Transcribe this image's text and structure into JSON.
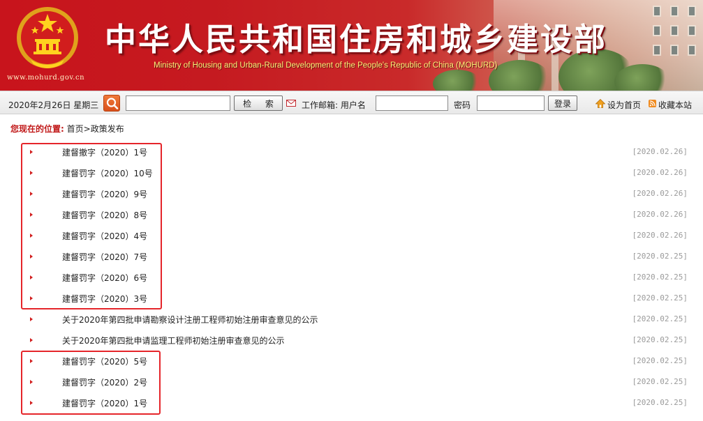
{
  "header": {
    "url": "www.mohurd.gov.cn",
    "title": "中华人民共和国住房和城乡建设部",
    "subtitle": "Ministry of Housing and Urban-Rural Development of the People's Republic of China (MOHURD)",
    "colors": {
      "banner_red": "#c8141c",
      "title_text": "#ffffff",
      "subtitle_text": "#fff27a"
    }
  },
  "toolbar": {
    "date": "2020年2月26日 星期三",
    "search_value": "",
    "search_button": "检 索",
    "mail_label": "工作邮箱: 用户名",
    "username_value": "",
    "password_label": "密码",
    "password_value": "",
    "login_button": "登录",
    "set_home": "设为首页",
    "bookmark": "收藏本站"
  },
  "breadcrumb": {
    "label": "您现在的位置:",
    "home": "首页",
    "separator": ">",
    "current": "政策发布"
  },
  "list": {
    "items": [
      {
        "title": "建督撤字（2020）1号",
        "date": "[2020.02.26]"
      },
      {
        "title": "建督罚字（2020）10号",
        "date": "[2020.02.26]"
      },
      {
        "title": "建督罚字（2020）9号",
        "date": "[2020.02.26]"
      },
      {
        "title": "建督罚字（2020）8号",
        "date": "[2020.02.26]"
      },
      {
        "title": "建督罚字（2020）4号",
        "date": "[2020.02.26]"
      },
      {
        "title": "建督罚字（2020）7号",
        "date": "[2020.02.25]"
      },
      {
        "title": "建督罚字（2020）6号",
        "date": "[2020.02.25]"
      },
      {
        "title": "建督罚字（2020）3号",
        "date": "[2020.02.25]"
      },
      {
        "title": "关于2020年第四批申请勘察设计注册工程师初始注册审查意见的公示",
        "date": "[2020.02.25]"
      },
      {
        "title": "关于2020年第四批申请监理工程师初始注册审查意见的公示",
        "date": "[2020.02.25]"
      },
      {
        "title": "建督罚字（2020）5号",
        "date": "[2020.02.25]"
      },
      {
        "title": "建督罚字（2020）2号",
        "date": "[2020.02.25]"
      },
      {
        "title": "建督罚字（2020）1号",
        "date": "[2020.02.25]"
      }
    ],
    "bullet_color": "#d11d1d",
    "highlight_color": "#e5252a"
  },
  "icons": {
    "search": "search-icon",
    "mail": "mail-icon",
    "home": "home-icon",
    "bookmark": "rss-bookmark-icon",
    "emblem": "national-emblem-icon"
  }
}
